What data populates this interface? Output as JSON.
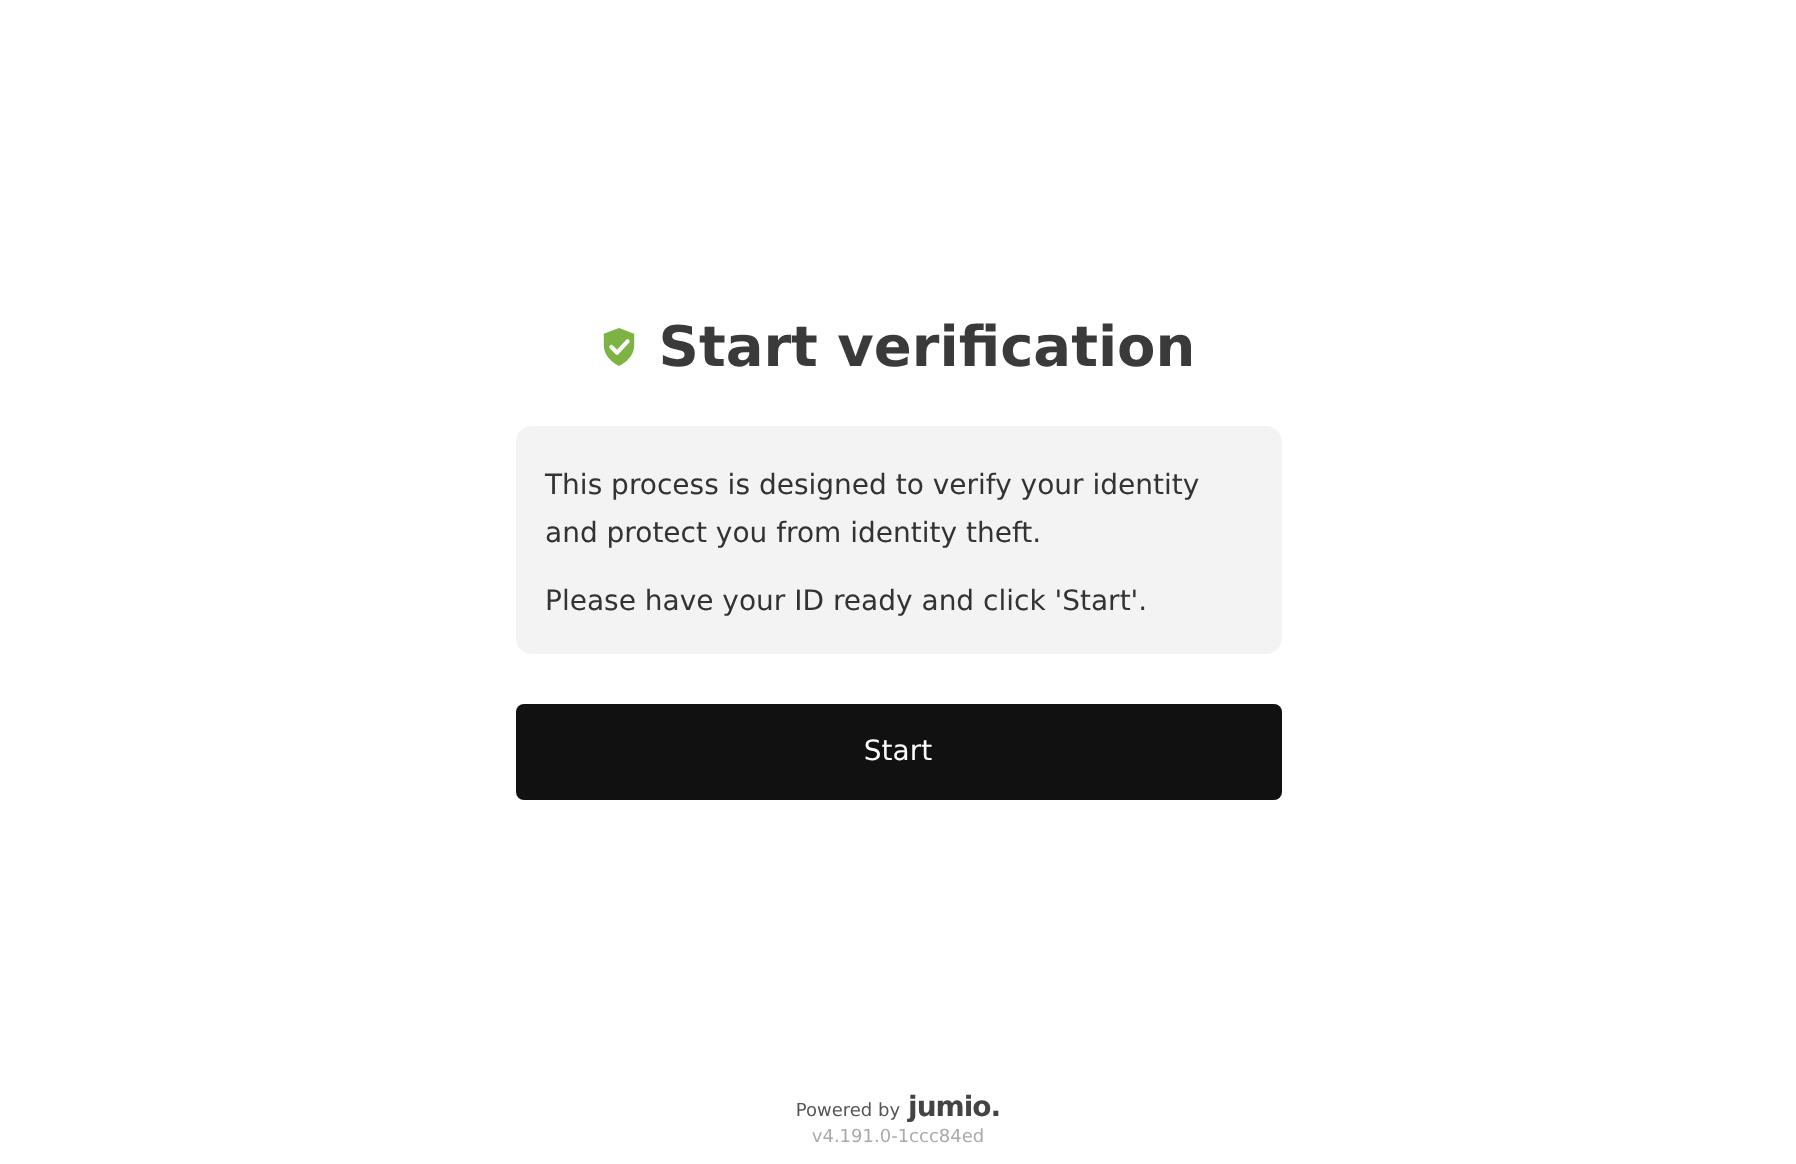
{
  "title": "Start verification",
  "info": [
    "This process is designed to verify your identity and protect you from identity theft.",
    "Please have your ID ready and click 'Start'."
  ],
  "button": "Start",
  "footer": {
    "powered_by": "Powered by",
    "logo": "jumio.",
    "version": "v4.191.0-1ccc84ed"
  }
}
